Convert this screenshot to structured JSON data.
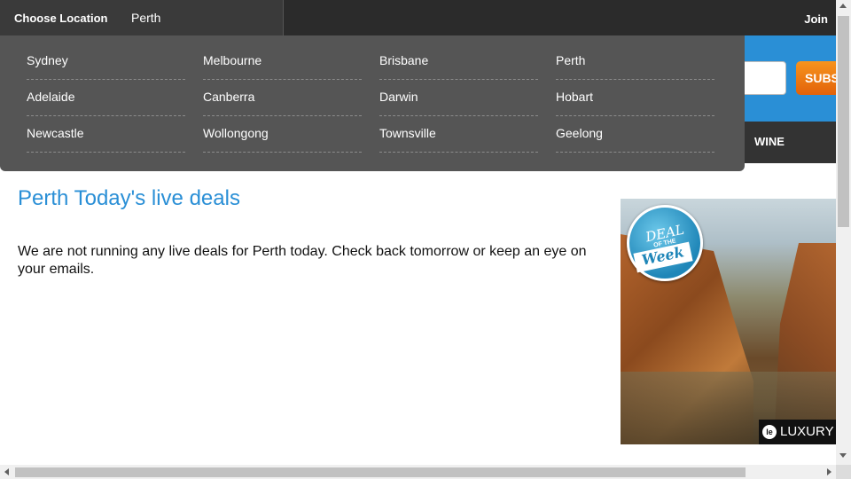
{
  "topbar": {
    "choose_location_label": "Choose Location",
    "current_location": "Perth",
    "join_label": "Join"
  },
  "header": {
    "subscribe_label": "SUBS",
    "nav_wine_label": "WINE"
  },
  "location_dropdown": {
    "cities": [
      [
        "Sydney",
        "Melbourne",
        "Brisbane",
        "Perth"
      ],
      [
        "Adelaide",
        "Canberra",
        "Darwin",
        "Hobart"
      ],
      [
        "Newcastle",
        "Wollongong",
        "Townsville",
        "Geelong"
      ]
    ]
  },
  "main": {
    "title": "Perth Today's live deals",
    "message": "We are not running any live deals for Perth today. Check back tomorrow or keep an eye on your emails."
  },
  "promo": {
    "badge_deal": "DEAL",
    "badge_of": "OF THE",
    "badge_week": "Week",
    "brand": "LUXURY",
    "brand_mark": "le"
  },
  "colors": {
    "accent_blue": "#2a8fd6",
    "dropdown_bg": "#555555",
    "subscribe_orange": "#f7941d"
  }
}
